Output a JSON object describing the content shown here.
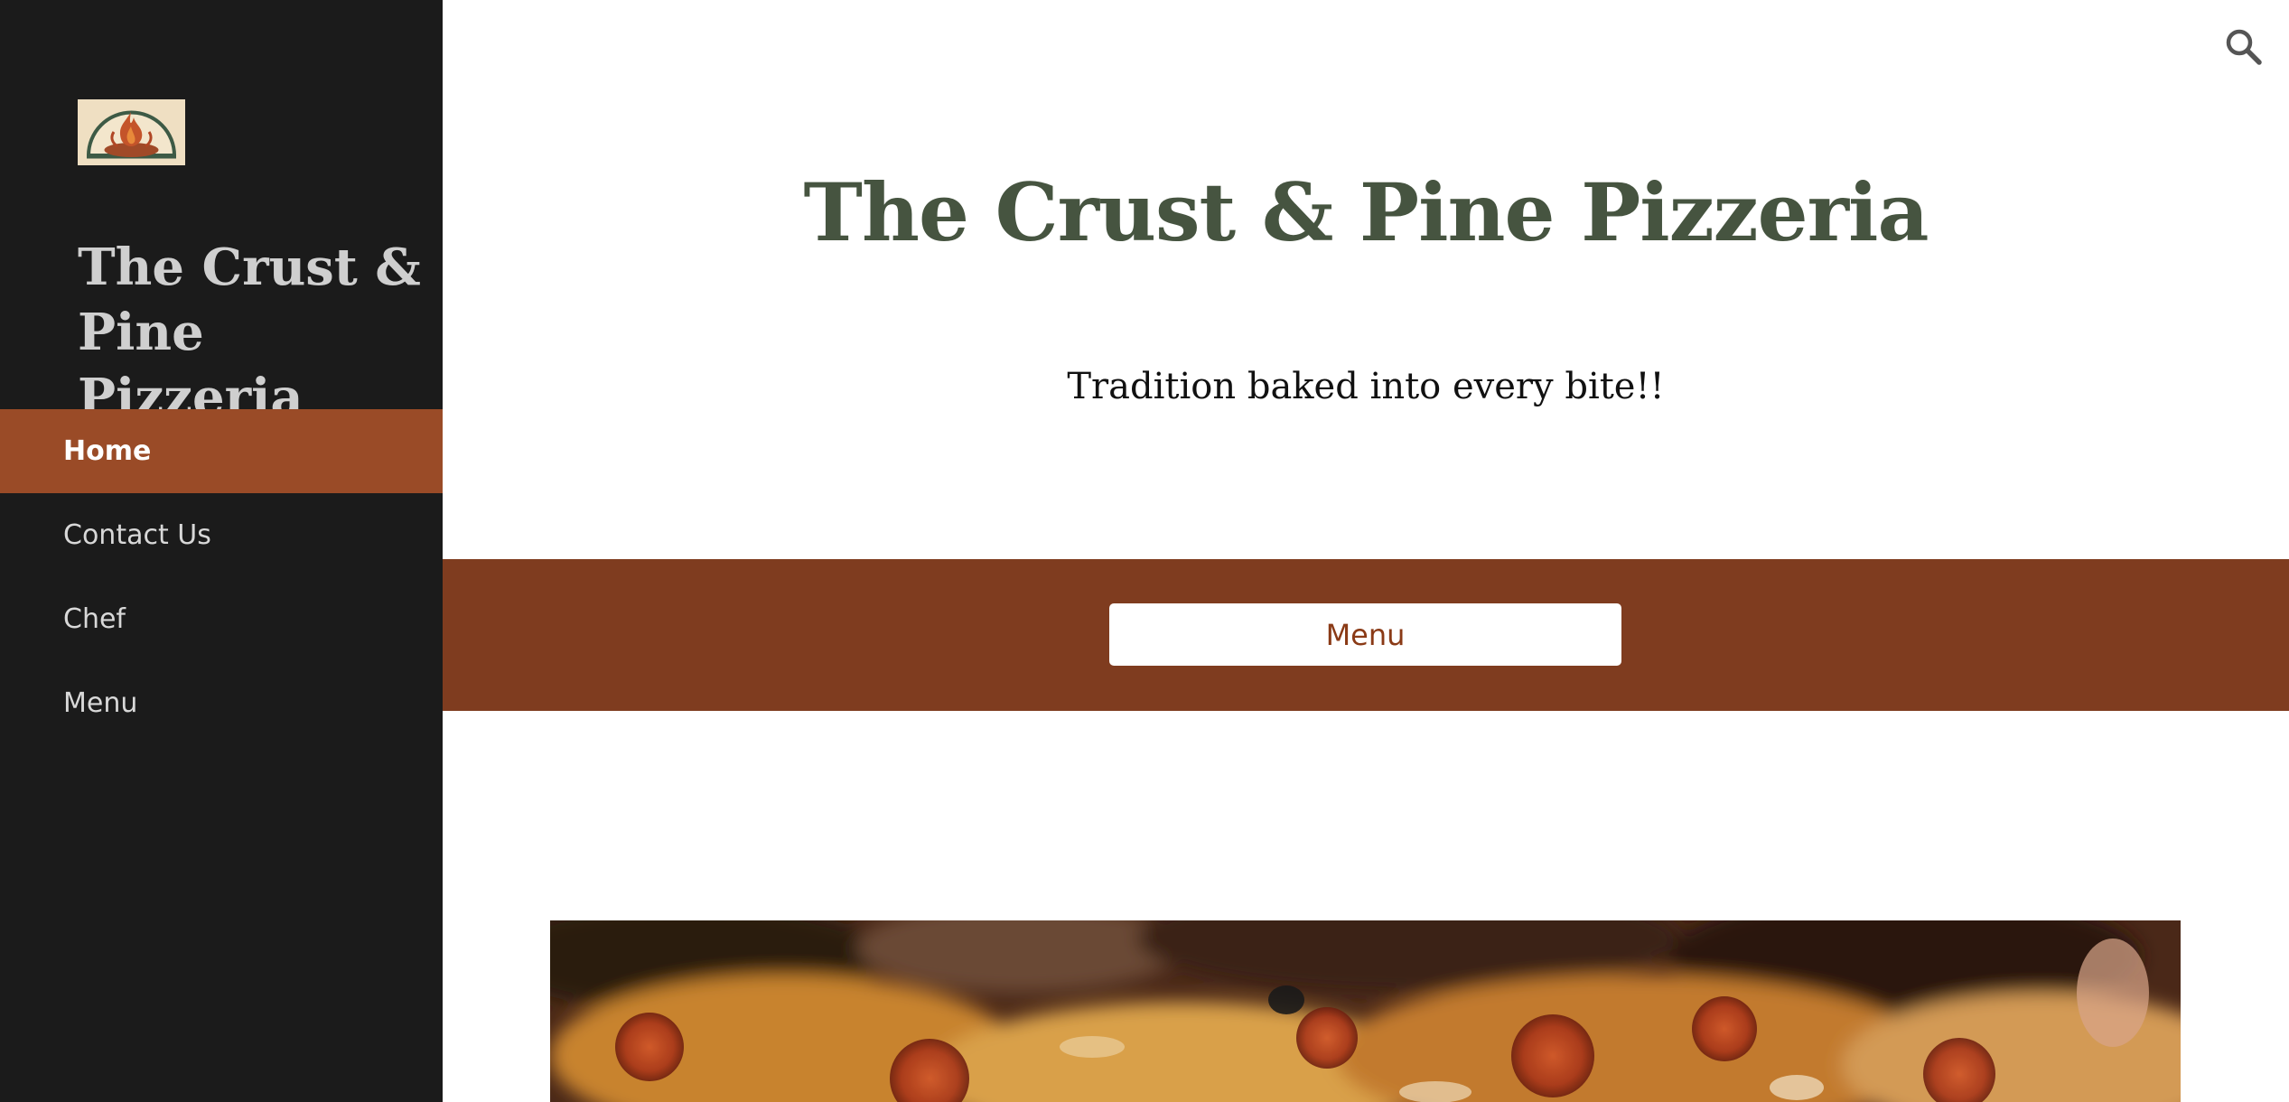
{
  "sidebar": {
    "site_title": "The Crust & Pine Pizzeria",
    "nav": [
      {
        "label": "Home",
        "active": true
      },
      {
        "label": "Contact Us",
        "active": false
      },
      {
        "label": "Chef",
        "active": false
      },
      {
        "label": "Menu",
        "active": false
      }
    ]
  },
  "header": {
    "search_icon": "search-icon"
  },
  "hero": {
    "title": "The Crust & Pine Pizzeria",
    "tagline": "Tradition baked into every bite!!"
  },
  "band": {
    "button_label": "Menu"
  },
  "colors": {
    "sidebar_bg": "#1b1b1b",
    "nav_active_bg": "#9a4b27",
    "title_green": "#465440",
    "band_bg": "#7f3c1f",
    "button_text": "#8a3a16"
  }
}
